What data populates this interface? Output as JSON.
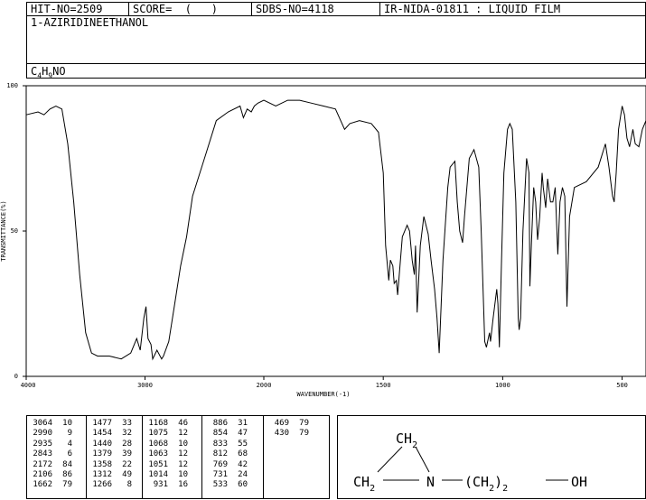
{
  "header": {
    "hit_no": "HIT-NO=2509",
    "score": "SCORE=  (   )",
    "sdbs_no": "SDBS-NO=4118",
    "method": "IR-NIDA-01811 : LIQUID FILM"
  },
  "compound_name": "1-AZIRIDINEETHANOL",
  "formula": {
    "c": "C",
    "c_n": "4",
    "h": "H",
    "h_n": "9",
    "rest": "NO"
  },
  "chart_data": {
    "type": "line",
    "xlabel": "WAVENUMBER(-1)",
    "ylabel": "TRANSMITTANCE(%)",
    "x_ticks": [
      "4000",
      "3000",
      "2000",
      "1500",
      "1000",
      "500"
    ],
    "y_ticks": [
      "100",
      "50",
      "0"
    ],
    "xlim": [
      4000,
      400
    ],
    "ylim": [
      0,
      100
    ],
    "x_scale": "piecewise (2x scale below 2000)",
    "series": [
      {
        "points": [
          [
            4000,
            90
          ],
          [
            3900,
            91
          ],
          [
            3850,
            90
          ],
          [
            3800,
            92
          ],
          [
            3750,
            93
          ],
          [
            3700,
            92
          ],
          [
            3650,
            80
          ],
          [
            3600,
            60
          ],
          [
            3550,
            35
          ],
          [
            3500,
            15
          ],
          [
            3450,
            8
          ],
          [
            3400,
            7
          ],
          [
            3300,
            7
          ],
          [
            3200,
            6
          ],
          [
            3120,
            8
          ],
          [
            3070,
            13
          ],
          [
            3040,
            9
          ],
          [
            3010,
            20
          ],
          [
            2992,
            24
          ],
          [
            2975,
            13
          ],
          [
            2950,
            11
          ],
          [
            2935,
            6
          ],
          [
            2900,
            9
          ],
          [
            2860,
            6
          ],
          [
            2845,
            7
          ],
          [
            2800,
            12
          ],
          [
            2750,
            25
          ],
          [
            2700,
            38
          ],
          [
            2650,
            48
          ],
          [
            2600,
            62
          ],
          [
            2500,
            75
          ],
          [
            2400,
            88
          ],
          [
            2300,
            91
          ],
          [
            2200,
            93
          ],
          [
            2172,
            89
          ],
          [
            2140,
            92
          ],
          [
            2106,
            91
          ],
          [
            2080,
            93
          ],
          [
            2050,
            94
          ],
          [
            2000,
            95
          ],
          [
            1950,
            93
          ],
          [
            1900,
            95
          ],
          [
            1850,
            95
          ],
          [
            1800,
            94
          ],
          [
            1750,
            93
          ],
          [
            1700,
            92
          ],
          [
            1662,
            85
          ],
          [
            1640,
            87
          ],
          [
            1600,
            88
          ],
          [
            1550,
            87
          ],
          [
            1520,
            84
          ],
          [
            1500,
            70
          ],
          [
            1490,
            45
          ],
          [
            1477,
            33
          ],
          [
            1470,
            40
          ],
          [
            1460,
            38
          ],
          [
            1454,
            32
          ],
          [
            1445,
            33
          ],
          [
            1440,
            28
          ],
          [
            1420,
            48
          ],
          [
            1400,
            52
          ],
          [
            1390,
            50
          ],
          [
            1379,
            40
          ],
          [
            1370,
            35
          ],
          [
            1365,
            45
          ],
          [
            1358,
            22
          ],
          [
            1345,
            45
          ],
          [
            1330,
            55
          ],
          [
            1315,
            50
          ],
          [
            1312,
            49
          ],
          [
            1300,
            40
          ],
          [
            1285,
            30
          ],
          [
            1275,
            20
          ],
          [
            1266,
            8
          ],
          [
            1250,
            40
          ],
          [
            1230,
            65
          ],
          [
            1220,
            72
          ],
          [
            1200,
            74
          ],
          [
            1190,
            60
          ],
          [
            1180,
            50
          ],
          [
            1168,
            46
          ],
          [
            1160,
            55
          ],
          [
            1140,
            75
          ],
          [
            1120,
            78
          ],
          [
            1100,
            72
          ],
          [
            1090,
            50
          ],
          [
            1075,
            12
          ],
          [
            1068,
            10
          ],
          [
            1063,
            12
          ],
          [
            1055,
            15
          ],
          [
            1051,
            12
          ],
          [
            1040,
            20
          ],
          [
            1025,
            30
          ],
          [
            1020,
            25
          ],
          [
            1014,
            10
          ],
          [
            1005,
            40
          ],
          [
            995,
            70
          ],
          [
            980,
            85
          ],
          [
            970,
            87
          ],
          [
            960,
            85
          ],
          [
            945,
            60
          ],
          [
            935,
            20
          ],
          [
            931,
            16
          ],
          [
            925,
            20
          ],
          [
            915,
            50
          ],
          [
            900,
            75
          ],
          [
            890,
            70
          ],
          [
            886,
            31
          ],
          [
            880,
            45
          ],
          [
            870,
            65
          ],
          [
            862,
            60
          ],
          [
            854,
            47
          ],
          [
            845,
            55
          ],
          [
            835,
            70
          ],
          [
            830,
            65
          ],
          [
            820,
            58
          ],
          [
            812,
            68
          ],
          [
            800,
            60
          ],
          [
            790,
            60
          ],
          [
            780,
            65
          ],
          [
            769,
            42
          ],
          [
            760,
            60
          ],
          [
            750,
            65
          ],
          [
            740,
            62
          ],
          [
            731,
            24
          ],
          [
            720,
            55
          ],
          [
            700,
            65
          ],
          [
            650,
            67
          ],
          [
            600,
            72
          ],
          [
            570,
            80
          ],
          [
            555,
            72
          ],
          [
            540,
            62
          ],
          [
            533,
            60
          ],
          [
            525,
            70
          ],
          [
            515,
            85
          ],
          [
            500,
            93
          ],
          [
            490,
            90
          ],
          [
            480,
            82
          ],
          [
            469,
            79
          ],
          [
            455,
            85
          ],
          [
            445,
            80
          ],
          [
            430,
            79
          ],
          [
            415,
            85
          ],
          [
            400,
            88
          ]
        ]
      }
    ],
    "peaks": [
      [
        3064,
        10
      ],
      [
        2990,
        9
      ],
      [
        2935,
        4
      ],
      [
        2843,
        6
      ],
      [
        2172,
        84
      ],
      [
        2106,
        86
      ],
      [
        1662,
        79
      ],
      [
        1477,
        33
      ],
      [
        1454,
        32
      ],
      [
        1440,
        28
      ],
      [
        1379,
        39
      ],
      [
        1358,
        22
      ],
      [
        1312,
        49
      ],
      [
        1266,
        8
      ],
      [
        1168,
        46
      ],
      [
        1075,
        12
      ],
      [
        1068,
        10
      ],
      [
        1063,
        12
      ],
      [
        1051,
        12
      ],
      [
        1014,
        10
      ],
      [
        931,
        16
      ],
      [
        886,
        31
      ],
      [
        854,
        47
      ],
      [
        833,
        55
      ],
      [
        812,
        68
      ],
      [
        769,
        42
      ],
      [
        731,
        24
      ],
      [
        533,
        60
      ],
      [
        469,
        79
      ],
      [
        430,
        79
      ]
    ]
  },
  "structure": {
    "top": "CH",
    "top_sub": "2",
    "left": "CH",
    "left_sub": "2",
    "n": "N",
    "chain": "(CH",
    "chain_sub": "2",
    "chain_close": ")",
    "chain_n": "2",
    "oh": "OH"
  }
}
